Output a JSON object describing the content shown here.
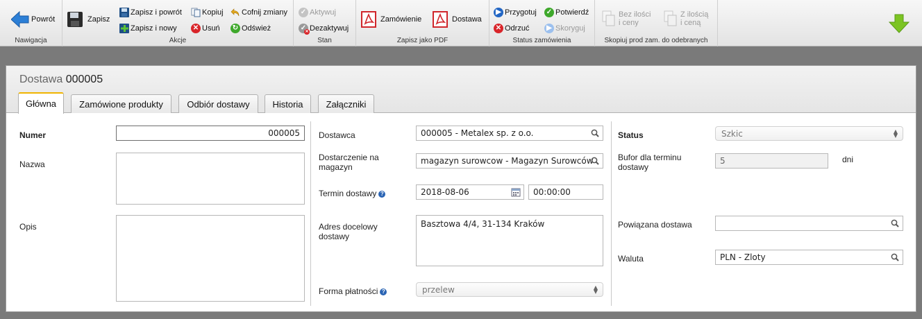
{
  "toolbar": {
    "back": "Powrót",
    "save": "Zapisz",
    "save_back": "Zapisz i powrót",
    "save_new": "Zapisz i nowy",
    "copy": "Kopiuj",
    "delete": "Usuń",
    "undo": "Cofnij zmiany",
    "refresh": "Odśwież",
    "activate": "Aktywuj",
    "deactivate": "Dezaktywuj",
    "pdf_order": "Zamówienie",
    "pdf_delivery": "Dostawa",
    "prepare": "Przygotuj",
    "confirm": "Potwierdź",
    "reject": "Odrzuć",
    "correct": "Skoryguj",
    "no_qty_1": "Bez ilości",
    "no_qty_2": "i ceny",
    "with_qty_1": "Z ilością",
    "with_qty_2": "i ceną",
    "groups": {
      "nav": "Nawigacja",
      "actions": "Akcje",
      "state": "Stan",
      "pdf": "Zapisz jako PDF",
      "status": "Status zamówienia",
      "copy": "Skopiuj prod zam. do odebranych"
    }
  },
  "header": {
    "prefix": "Dostawa",
    "number": "000005"
  },
  "tabs": [
    "Główna",
    "Zamówione produkty",
    "Odbiór dostawy",
    "Historia",
    "Załączniki"
  ],
  "form": {
    "col1": {
      "number_label": "Numer",
      "number_value": "000005",
      "name_label": "Nazwa",
      "desc_label": "Opis"
    },
    "col2": {
      "supplier_label": "Dostawca",
      "supplier_value": "000005 - Metalex sp. z o.o.",
      "warehouse_label_1": "Dostarczenie na",
      "warehouse_label_2": "magazyn",
      "warehouse_value": "magazyn surowcow - Magazyn Surowców",
      "date_label": "Termin dostawy",
      "date_value": "2018-08-06",
      "time_value": "00:00:00",
      "address_label_1": "Adres docelowy",
      "address_label_2": "dostawy",
      "address_value": "Basztowa 4/4, 31-134 Kraków",
      "payment_label": "Forma płatności",
      "payment_value": "przelew"
    },
    "col3": {
      "status_label": "Status",
      "status_value": "Szkic",
      "buffer_label_1": "Bufor dla terminu",
      "buffer_label_2": "dostawy",
      "buffer_value": "5",
      "buffer_unit": "dni",
      "related_label": "Powiązana dostawa",
      "currency_label": "Waluta",
      "currency_value": "PLN - Zloty"
    }
  },
  "colors": {
    "pdf_red": "#d0262b",
    "accent_tab": "#f0b400",
    "blue_arrow": "#2c7fd6",
    "green_arrow": "#7cc423"
  }
}
